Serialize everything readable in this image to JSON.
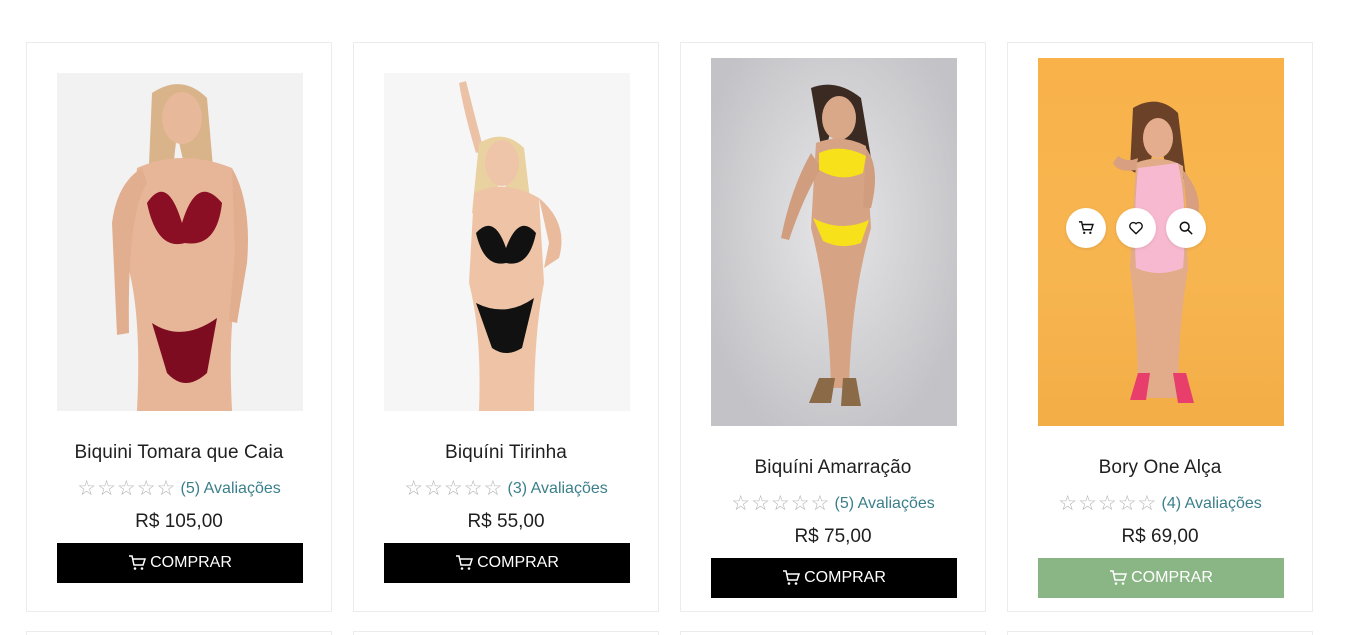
{
  "products": [
    {
      "title": "Biquini Tomara que Caia",
      "rating_stars": 0,
      "reviews": "(5) Avaliações",
      "price": "R$ 105,00",
      "buy_label": "COMPRAR",
      "image_colors": {
        "background": "#f2f2f2",
        "swimsuit": "#8a0f24"
      }
    },
    {
      "title": "Biquíni Tirinha",
      "rating_stars": 0,
      "reviews": "(3) Avaliações",
      "price": "R$ 55,00",
      "buy_label": "COMPRAR",
      "image_colors": {
        "background": "#f6f6f6",
        "swimsuit": "#111111"
      }
    },
    {
      "title": "Biquíni Amarração",
      "rating_stars": 0,
      "reviews": "(5) Avaliações",
      "price": "R$ 75,00",
      "buy_label": "COMPRAR",
      "image_colors": {
        "background": "#c9c9cd",
        "swimsuit": "#f7e11b"
      }
    },
    {
      "title": "Bory One Alça",
      "rating_stars": 0,
      "reviews": "(4) Avaliações",
      "price": "R$ 69,00",
      "buy_label": "COMPRAR",
      "image_colors": {
        "background": "#f7b24a",
        "swimsuit": "#f7b9cf"
      },
      "hover_actions": [
        "cart-icon",
        "heart-icon",
        "search-icon"
      ]
    }
  ],
  "colors": {
    "buy_button": "#000000",
    "buy_button_hover": "#8ab585",
    "review_link": "#3b7f8a",
    "star_empty": "#b5b5b5"
  }
}
